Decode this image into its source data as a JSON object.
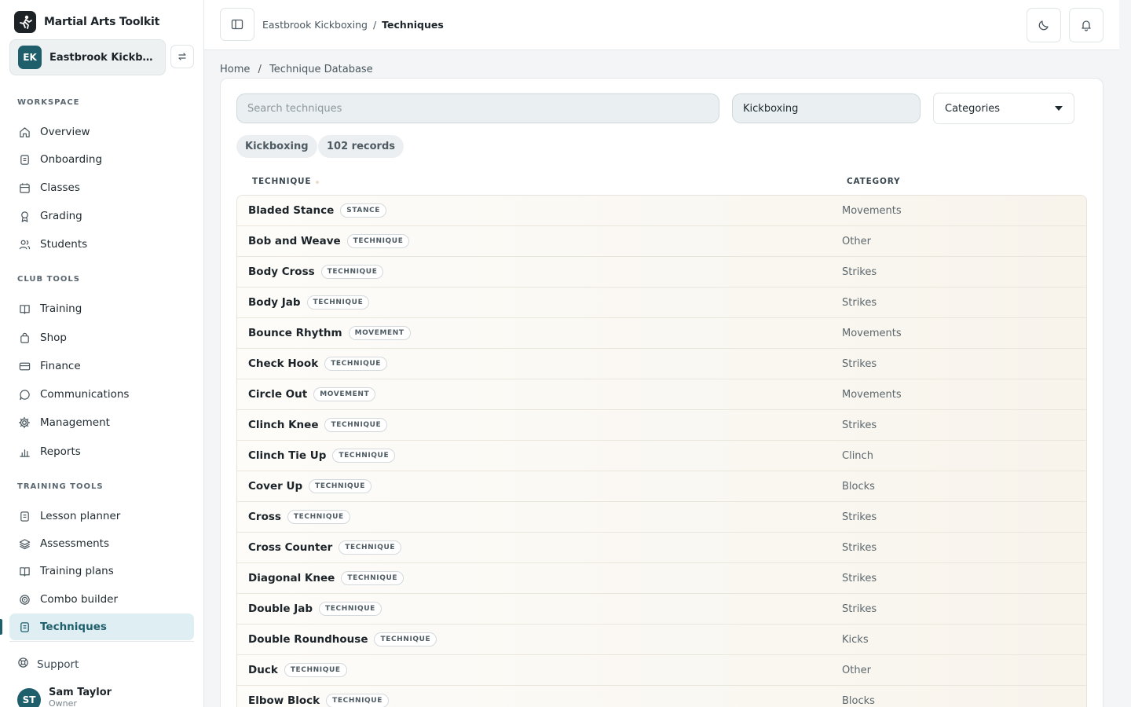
{
  "app": {
    "name": "Martial Arts Toolkit"
  },
  "club": {
    "initials": "EK",
    "name": "Eastbrook Kickboxing"
  },
  "sidebar": {
    "sections": [
      {
        "title": "WORKSPACE",
        "items": [
          {
            "label": "Overview",
            "icon": "home-icon"
          },
          {
            "label": "Onboarding",
            "icon": "clipboard-icon"
          },
          {
            "label": "Classes",
            "icon": "calendar-icon"
          },
          {
            "label": "Grading",
            "icon": "award-icon"
          },
          {
            "label": "Students",
            "icon": "users-icon"
          }
        ]
      },
      {
        "title": "CLUB TOOLS",
        "items": [
          {
            "label": "Training",
            "icon": "book-icon"
          },
          {
            "label": "Shop",
            "icon": "bag-icon"
          },
          {
            "label": "Finance",
            "icon": "credit-card-icon"
          },
          {
            "label": "Communications",
            "icon": "chat-icon"
          },
          {
            "label": "Management",
            "icon": "gear-icon"
          },
          {
            "label": "Reports",
            "icon": "bar-chart-icon"
          }
        ]
      },
      {
        "title": "TRAINING TOOLS",
        "items": [
          {
            "label": "Lesson planner",
            "icon": "clipboard-icon"
          },
          {
            "label": "Assessments",
            "icon": "layers-icon"
          },
          {
            "label": "Training plans",
            "icon": "book-icon"
          },
          {
            "label": "Combo builder",
            "icon": "target-icon"
          },
          {
            "label": "Techniques",
            "icon": "document-icon",
            "active": true
          }
        ]
      }
    ],
    "support_label": "Support",
    "user": {
      "initials": "ST",
      "name": "Sam Taylor",
      "role": "Owner"
    }
  },
  "topbar": {
    "crumb_parent": "Eastbrook Kickboxing",
    "crumb_sep": "/",
    "crumb_current": "Techniques"
  },
  "page": {
    "crumb_home": "Home",
    "crumb_sep": "/",
    "crumb_current": "Technique Database"
  },
  "filters": {
    "search_placeholder": "Search techniques",
    "style_value": "Kickboxing",
    "category_value": "Categories"
  },
  "chips": {
    "style": "Kickboxing",
    "count": "102 records"
  },
  "table": {
    "headers": {
      "technique": "TECHNIQUE",
      "category": "CATEGORY"
    },
    "rows": [
      {
        "name": "Bladed Stance",
        "type": "STANCE",
        "category": "Movements"
      },
      {
        "name": "Bob and Weave",
        "type": "TECHNIQUE",
        "category": "Other"
      },
      {
        "name": "Body Cross",
        "type": "TECHNIQUE",
        "category": "Strikes"
      },
      {
        "name": "Body Jab",
        "type": "TECHNIQUE",
        "category": "Strikes"
      },
      {
        "name": "Bounce Rhythm",
        "type": "MOVEMENT",
        "category": "Movements"
      },
      {
        "name": "Check Hook",
        "type": "TECHNIQUE",
        "category": "Strikes"
      },
      {
        "name": "Circle Out",
        "type": "MOVEMENT",
        "category": "Movements"
      },
      {
        "name": "Clinch Knee",
        "type": "TECHNIQUE",
        "category": "Strikes"
      },
      {
        "name": "Clinch Tie Up",
        "type": "TECHNIQUE",
        "category": "Clinch"
      },
      {
        "name": "Cover Up",
        "type": "TECHNIQUE",
        "category": "Blocks"
      },
      {
        "name": "Cross",
        "type": "TECHNIQUE",
        "category": "Strikes"
      },
      {
        "name": "Cross Counter",
        "type": "TECHNIQUE",
        "category": "Strikes"
      },
      {
        "name": "Diagonal Knee",
        "type": "TECHNIQUE",
        "category": "Strikes"
      },
      {
        "name": "Double Jab",
        "type": "TECHNIQUE",
        "category": "Strikes"
      },
      {
        "name": "Double Roundhouse",
        "type": "TECHNIQUE",
        "category": "Kicks"
      },
      {
        "name": "Duck",
        "type": "TECHNIQUE",
        "category": "Other"
      },
      {
        "name": "Elbow Block",
        "type": "TECHNIQUE",
        "category": "Blocks"
      }
    ]
  },
  "colors": {
    "accent": "#1e5f6b",
    "active_bg": "#deeef2",
    "row_tint": "#f8f4ec"
  }
}
